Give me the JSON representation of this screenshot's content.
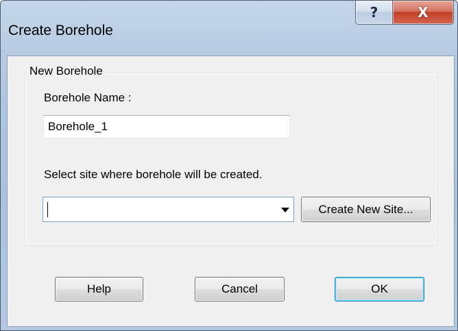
{
  "window": {
    "title": "Create Borehole",
    "help_glyph": "?",
    "close_glyph": "X"
  },
  "group": {
    "legend": "New Borehole",
    "name_label": "Borehole Name :",
    "name_value": "Borehole_1",
    "site_label": "Select site where borehole will be created.",
    "site_value": "",
    "create_site_label": "Create New Site..."
  },
  "buttons": {
    "help_label": "Help",
    "cancel_label": "Cancel",
    "ok_label": "OK"
  },
  "icons": {
    "help": "question-mark-icon",
    "close": "close-icon",
    "dropdown": "chevron-down-icon"
  }
}
